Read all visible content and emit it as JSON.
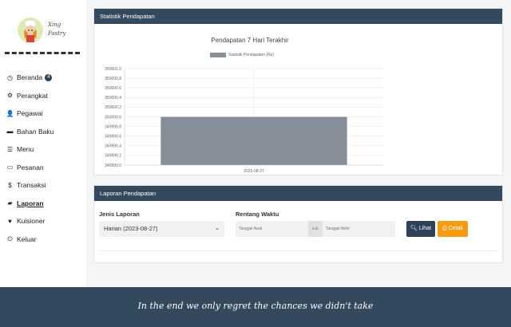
{
  "brand": {
    "line1": "Xing",
    "line2": "Pastry"
  },
  "nav": [
    {
      "label": "Beranda",
      "icon": "clock-icon",
      "glyph": "◷",
      "badge": "4",
      "active": false
    },
    {
      "label": "Perangkat",
      "icon": "gear-icon",
      "glyph": "⚙",
      "badge": "",
      "active": false
    },
    {
      "label": "Pegawai",
      "icon": "user-icon",
      "glyph": "👤",
      "badge": "",
      "active": false
    },
    {
      "label": "Bahan Baku",
      "icon": "box-icon",
      "glyph": "▬",
      "badge": "",
      "active": false
    },
    {
      "label": "Menu",
      "icon": "list-icon",
      "glyph": "☰",
      "badge": "",
      "active": false
    },
    {
      "label": "Pesanan",
      "icon": "cart-icon",
      "glyph": "▭",
      "badge": "",
      "active": false
    },
    {
      "label": "Transaksi",
      "icon": "dollar-icon",
      "glyph": "$",
      "badge": "",
      "active": false
    },
    {
      "label": "Laporan",
      "icon": "folder-open-icon",
      "glyph": "▰",
      "badge": "",
      "active": true
    },
    {
      "label": "Kuisioner",
      "icon": "heart-icon",
      "glyph": "♥",
      "badge": "",
      "active": false
    },
    {
      "label": "Keluar",
      "icon": "power-icon",
      "glyph": "⏻",
      "badge": "",
      "active": false
    }
  ],
  "stats_card": {
    "header": "Statistik Pendapatan"
  },
  "chart_data": {
    "type": "bar",
    "title": "Pendapatan 7 Hari Terakhir",
    "categories": [
      "2023-08-27"
    ],
    "series": [
      {
        "name": "Statistik Pendapatan (Rp)",
        "values": [
          350000.0
        ]
      }
    ],
    "ylim": [
      349999.0,
      350001.0
    ],
    "yticks": [
      "350001.0",
      "350000.8",
      "350000.6",
      "350000.4",
      "350000.2",
      "350000.0",
      "349999.8",
      "349999.6",
      "349999.4",
      "349999.2",
      "349999.0"
    ],
    "grid": true,
    "legend_position": "top",
    "bar_color": "#858e99"
  },
  "report_card": {
    "header": "Laporan Pendapatan",
    "jenis_label": "Jenis Laporan",
    "jenis_value": "Harian (2023-08-27)",
    "rentang_label": "Rentang Waktu",
    "start_placeholder": "Tanggal Awal",
    "sd": "s.d.",
    "end_placeholder": "Tanggal Akhir",
    "lihat": "Lihat",
    "cetak": "Cetak"
  },
  "footer": {
    "quote": "In the end we only regret the chances we didn't take"
  },
  "colors": {
    "primary": "#34495e",
    "accent": "#f39c12"
  }
}
